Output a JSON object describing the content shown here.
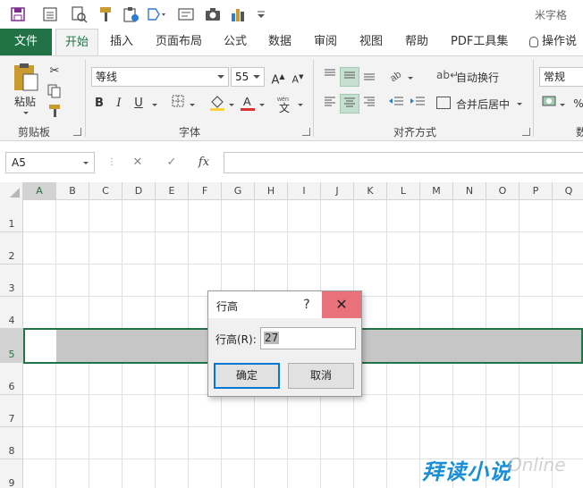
{
  "qat": {
    "user_name": "米字格",
    "icons": [
      "save-icon",
      "form-icon",
      "print-preview-icon",
      "format-painter-icon",
      "paste-special-icon",
      "shape-icon",
      "text-box-icon",
      "camera-icon",
      "chart-icon",
      "customize-icon"
    ]
  },
  "tabs": [
    {
      "label": "文件",
      "active": false
    },
    {
      "label": "开始",
      "active": true
    },
    {
      "label": "插入",
      "active": false
    },
    {
      "label": "页面布局",
      "active": false
    },
    {
      "label": "公式",
      "active": false
    },
    {
      "label": "数据",
      "active": false
    },
    {
      "label": "审阅",
      "active": false
    },
    {
      "label": "视图",
      "active": false
    },
    {
      "label": "帮助",
      "active": false
    },
    {
      "label": "PDF工具集",
      "active": false
    },
    {
      "label": "操作说",
      "active": false
    }
  ],
  "ribbon": {
    "clipboard": {
      "group_label": "剪贴板",
      "paste_label": "粘贴"
    },
    "font": {
      "group_label": "字体",
      "font_name": "等线",
      "font_size": "55",
      "bold": "B",
      "italic": "I",
      "underline": "U",
      "font_color": "#e03131",
      "fill_color": "#ffd43b"
    },
    "alignment": {
      "group_label": "对齐方式",
      "wrap_text": "自动换行",
      "merge_center": "合并后居中"
    },
    "number": {
      "format": "常规",
      "group_label": "数"
    }
  },
  "formula_bar": {
    "name_box": "A5",
    "cancel": "✕",
    "enter": "✓",
    "fx": "fx",
    "content": ""
  },
  "grid": {
    "columns": [
      "A",
      "B",
      "C",
      "D",
      "E",
      "F",
      "G",
      "H",
      "I",
      "J",
      "K",
      "L",
      "M",
      "N",
      "O",
      "P",
      "Q"
    ],
    "rows": [
      "1",
      "2",
      "3",
      "4",
      "5",
      "6",
      "7",
      "8",
      "9"
    ],
    "selected_row": "5",
    "active_cell": "A5"
  },
  "dialog": {
    "title": "行高",
    "help": "?",
    "close": "✕",
    "field_label": "行高(R):",
    "field_value": "27",
    "ok_label": "确定",
    "cancel_label": "取消"
  },
  "watermark": {
    "text": "拜读小说",
    "sub": "Online"
  },
  "colors": {
    "excel_green": "#217346",
    "selection_gray": "#c6c6c6",
    "close_red": "#e8717a",
    "focus_blue": "#0078d7"
  }
}
